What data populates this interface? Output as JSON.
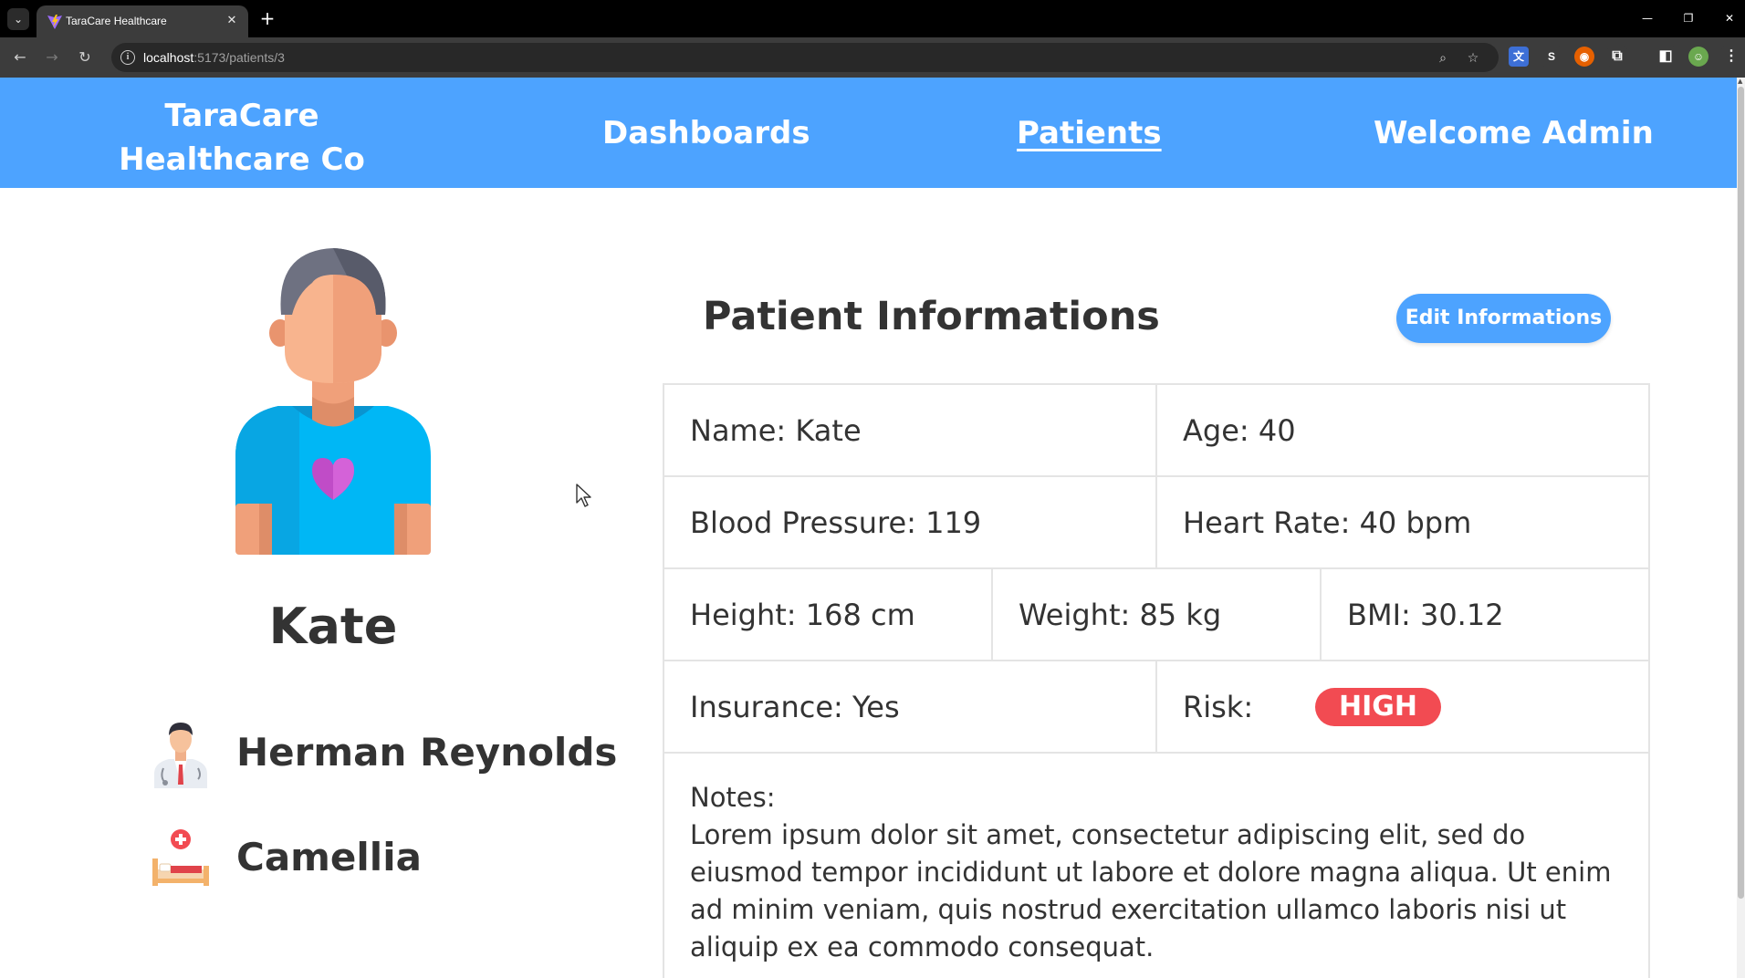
{
  "browser": {
    "tab_title": "TaraCare Healthcare",
    "url_host": "localhost",
    "url_rest": ":5173/patients/3"
  },
  "header": {
    "brand_line1": "TaraCare",
    "brand_line2": "Healthcare Co",
    "nav": {
      "dashboards": "Dashboards",
      "patients": "Patients",
      "welcome": "Welcome Admin"
    },
    "brand_color": "#4da3ff"
  },
  "profile": {
    "name": "Kate",
    "doctor": "Herman Reynolds",
    "room": "Camellia"
  },
  "info": {
    "title": "Patient Informations",
    "edit_label": "Edit Informations",
    "name": "Name: Kate",
    "age": "Age: 40",
    "blood_pressure": "Blood Pressure: 119",
    "heart_rate": "Heart Rate: 40 bpm",
    "height": "Height: 168 cm",
    "weight": "Weight: 85 kg",
    "bmi": "BMI: 30.12",
    "insurance": "Insurance: Yes",
    "risk_label": "Risk:",
    "risk_value": "HIGH",
    "risk_color": "#f24b52",
    "notes_label": "Notes:",
    "notes_text": "Lorem ipsum dolor sit amet, consectetur adipiscing elit, sed do eiusmod tempor incididunt ut labore et dolore magna aliqua. Ut enim ad minim veniam, quis nostrud exercitation ullamco laboris nisi ut aliquip ex ea commodo consequat."
  }
}
